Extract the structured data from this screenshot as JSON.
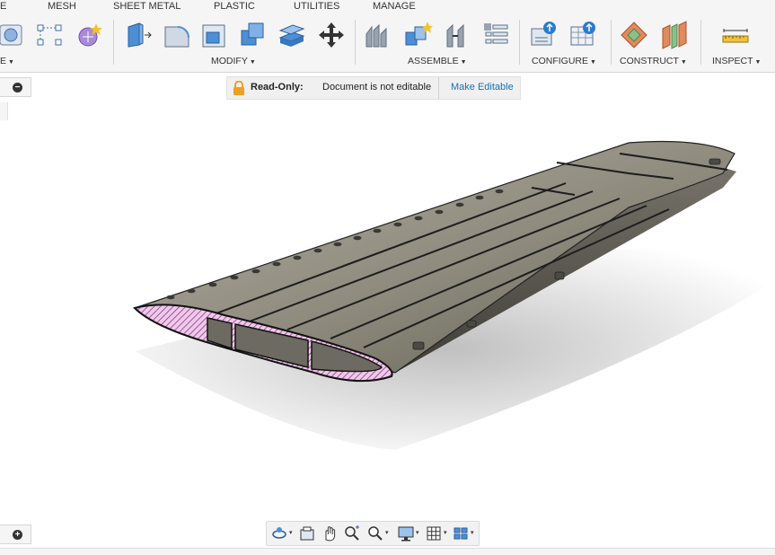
{
  "toolbar": {
    "tabs": [
      {
        "label": "E"
      },
      {
        "label": "MESH"
      },
      {
        "label": "SHEET METAL"
      },
      {
        "label": "PLASTIC"
      },
      {
        "label": "UTILITIES"
      },
      {
        "label": "MANAGE"
      }
    ],
    "groups": {
      "create": "E",
      "modify": "MODIFY",
      "assemble": "ASSEMBLE",
      "configure": "CONFIGURE",
      "construct": "CONSTRUCT",
      "inspect": "INSPECT"
    },
    "caret": "▼"
  },
  "readonly_banner": {
    "label": "Read-Only:",
    "message": "Document is not editable",
    "action": "Make Editable"
  },
  "side_panel": {
    "collapse_symbol": "−",
    "expand_symbol": "+"
  },
  "nav_bar": {
    "caret": "▾",
    "icons": [
      "orbit-icon",
      "look-at-icon",
      "pan-icon",
      "zoom-window-icon",
      "zoom-icon",
      "display-settings-icon",
      "grid-icon",
      "viewports-icon"
    ]
  },
  "colors": {
    "accent_blue": "#1a6fb5",
    "section_pink": "#e7a3e0",
    "wing_body": "#8a877c",
    "lock_orange": "#f0a020"
  }
}
